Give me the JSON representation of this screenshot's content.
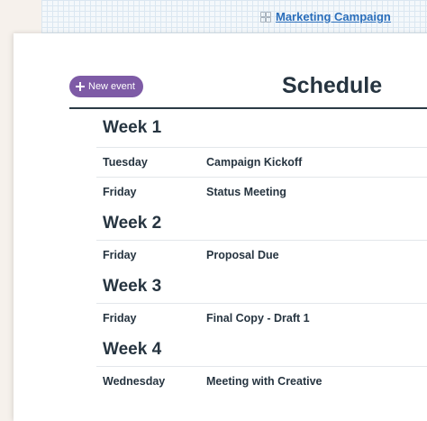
{
  "breadcrumb": {
    "link": "Marketing Campaign"
  },
  "toolbar": {
    "new_event_label": "New event"
  },
  "page": {
    "title": "Schedule"
  },
  "weeks": [
    {
      "label": "Week 1",
      "events": [
        {
          "day": "Tuesday",
          "event": "Campaign Kickoff"
        },
        {
          "day": "Friday",
          "event": "Status Meeting"
        }
      ]
    },
    {
      "label": "Week 2",
      "events": [
        {
          "day": "Friday",
          "event": "Proposal Due"
        }
      ]
    },
    {
      "label": "Week 3",
      "events": [
        {
          "day": "Friday",
          "event": "Final Copy - Draft 1"
        }
      ]
    },
    {
      "label": "Week 4",
      "events": [
        {
          "day": "Wednesday",
          "event": "Meeting with Creative"
        }
      ]
    }
  ],
  "colors": {
    "accent": "#7e5ba6",
    "link": "#2a6ebb",
    "text": "#263440"
  }
}
